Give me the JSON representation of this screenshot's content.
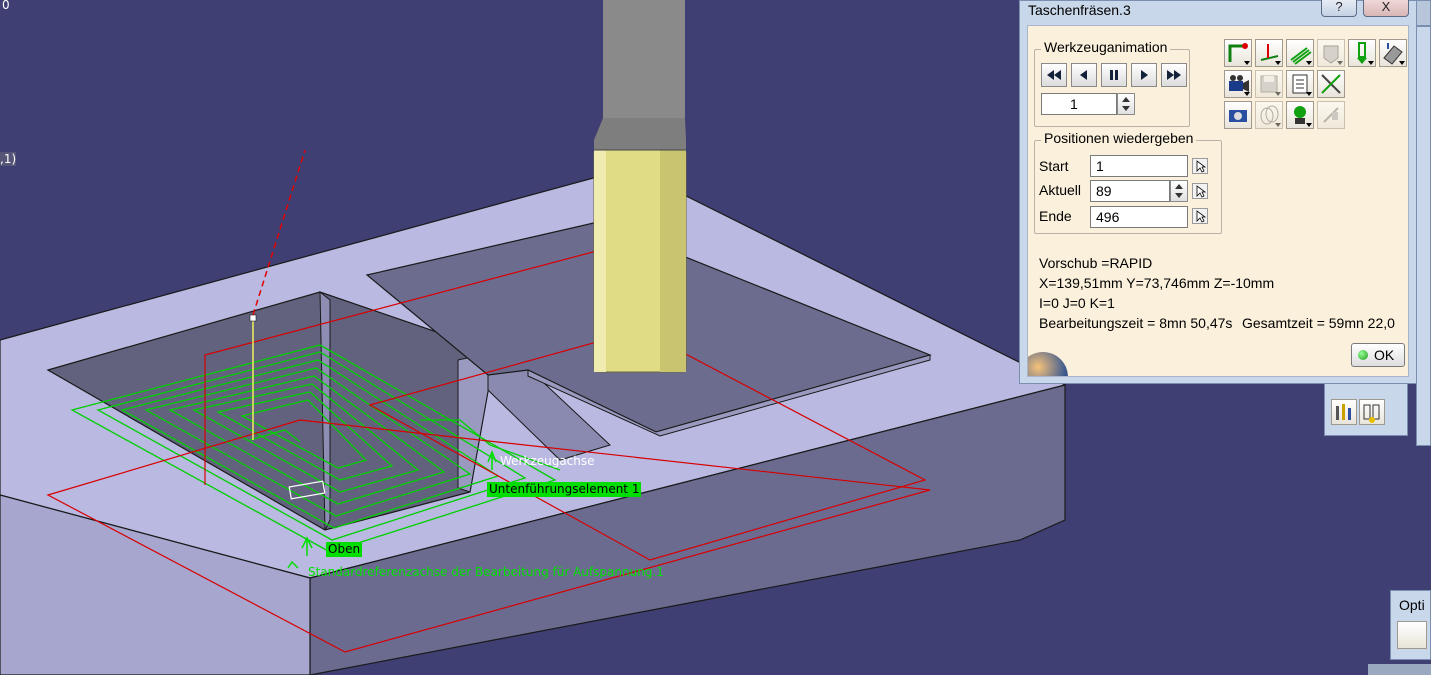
{
  "viewport": {
    "corner_text_top": "0",
    "corner_text_left": ",1)",
    "labels": {
      "werkzeugachse": "Werkzeugachse",
      "fuehrungselement": "Untenführungselement 1",
      "oben": "Oben",
      "referenzachse": "Standardreferenzachse der Bearbeitung für Aufspannung.1"
    },
    "colors": {
      "background": "#3f3f74",
      "part": "#b9b9e2",
      "toolpath_green": "#00d000",
      "toolpath_red": "#d80000",
      "tool_holder": "#8a8a8a",
      "tool_cutter": "#e0dc86"
    }
  },
  "dialog": {
    "title": "Taschenfräsen.3",
    "help_label": "?",
    "close_label": "X",
    "animation": {
      "group_title": "Werkzeuganimation",
      "nav_buttons": [
        "rewind-icon",
        "step-back-icon",
        "pause-icon",
        "step-forward-icon",
        "fast-forward-icon"
      ],
      "step_value": "1"
    },
    "positions": {
      "group_title": "Positionen wiedergeben",
      "start_label": "Start",
      "start_value": "1",
      "current_label": "Aktuell",
      "current_value": "89",
      "end_label": "Ende",
      "end_value": "496"
    },
    "info": {
      "feed": "Vorschub =RAPID",
      "xyz": "X=139,51mm Y=73,746mm Z=-10mm",
      "ijk": "I=0 J=0 K=1",
      "time": "Bearbeitungszeit = 8mn 50,47s",
      "total": "Gesamtzeit = 59mn 22,0"
    },
    "ok_label": "OK",
    "toolbar_icons": [
      "toolpath-display-icon",
      "point-display-icon",
      "tool-display-icon",
      "tool-assembly-icon",
      "holder-icon",
      "eraser-icon",
      "video-icon",
      "save-disabled-icon",
      "report-icon",
      "tool-crossed-icon",
      "photo-icon",
      "collision-disabled-icon",
      "analysis-icon",
      "machine-disabled-icon"
    ]
  },
  "side_panels": {
    "options_label": "Opti"
  }
}
